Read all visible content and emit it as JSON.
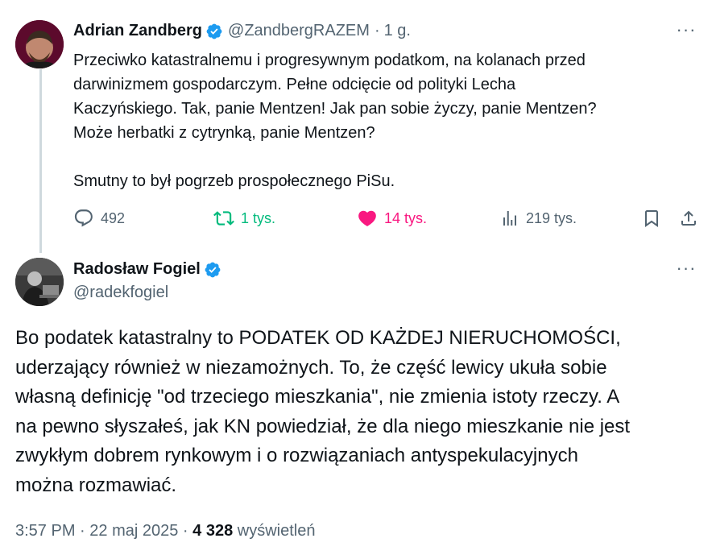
{
  "tweet1": {
    "name": "Adrian Zandberg",
    "handle": "@ZandbergRAZEM",
    "sep": "·",
    "time": "1 g.",
    "more": "···",
    "lines": [
      "Przeciwko katastralnemu i progresywnym podatkom, na kolanach przed",
      "darwinizmem gospodarczym. Pełne odcięcie od polityki Lecha",
      "Kaczyńskiego. Tak, panie Mentzen! Jak pan sobie życzy, panie Mentzen?",
      "Może herbatki z cytrynką, panie Mentzen?"
    ],
    "last_line": "Smutny to był pogrzeb prospołecznego PiSu.",
    "replies": "492",
    "retweets": "1 tys.",
    "likes": "14 tys.",
    "views": "219 tys."
  },
  "tweet2": {
    "name": "Radosław Fogiel",
    "handle": "@radekfogiel",
    "more": "···",
    "lines": [
      "Bo podatek katastralny to PODATEK OD KAŻDEJ NIERUCHOMOŚCI,",
      "uderzający również w niezamożnych. To, że część lewicy ukuła sobie",
      "własną definicję \"od trzeciego mieszkania\", nie zmienia istoty rzeczy.  A",
      "na pewno słyszałeś, jak KN powiedział, że dla niego mieszkanie nie jest",
      "zwykłym dobrem rynkowym i o rozwiązaniach antyspekulacyjnych",
      "można rozmawiać."
    ],
    "time": "3:57 PM",
    "date": "22 maj 2025",
    "views_count": "4 328",
    "views_label": "wyświetleń",
    "sep": "·"
  },
  "colors": {
    "verified": "#1d9bf0",
    "muted": "#536471",
    "retweet": "#00ba7c",
    "like": "#f91880"
  },
  "icons": [
    "verified-badge-icon",
    "reply-icon",
    "retweet-icon",
    "like-icon",
    "views-icon",
    "bookmark-icon",
    "share-icon",
    "more-icon"
  ]
}
